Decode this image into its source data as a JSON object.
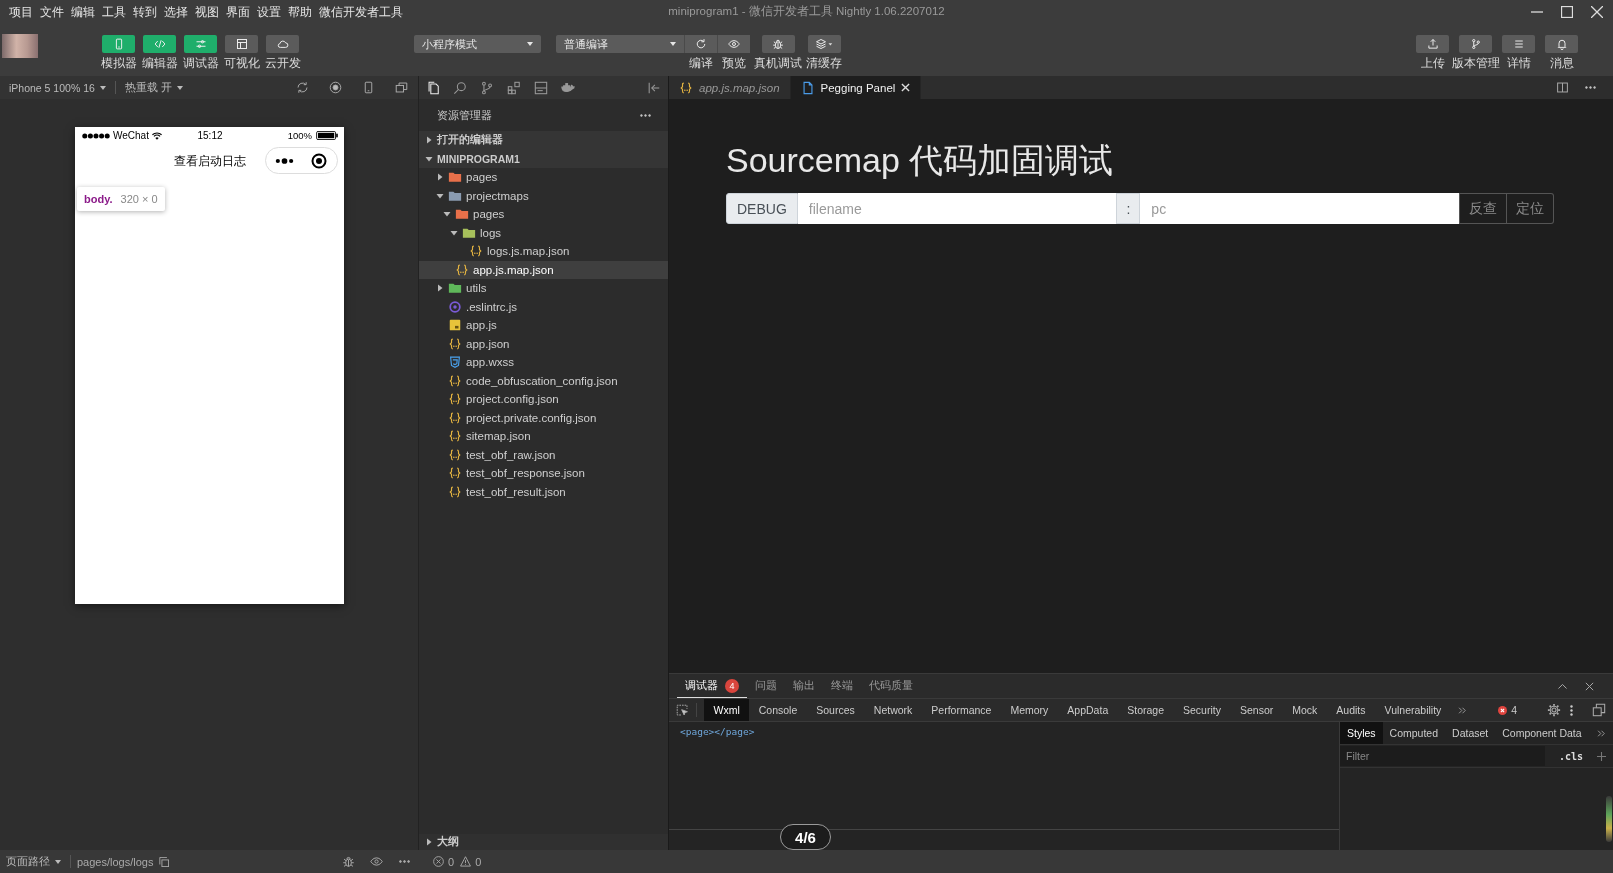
{
  "window": {
    "title": "miniprogram1 - 微信开发者工具 Nightly 1.06.2207012"
  },
  "menu": [
    "项目",
    "文件",
    "编辑",
    "工具",
    "转到",
    "选择",
    "视图",
    "界面",
    "设置",
    "帮助",
    "微信开发者工具"
  ],
  "toolbar": {
    "view_buttons": [
      {
        "label": "模拟器",
        "kind": "phone",
        "on": true
      },
      {
        "label": "编辑器",
        "kind": "code",
        "on": true
      },
      {
        "label": "调试器",
        "kind": "sliders",
        "on": true
      },
      {
        "label": "可视化",
        "kind": "layout",
        "on": false
      },
      {
        "label": "云开发",
        "kind": "cloud",
        "on": false
      }
    ],
    "mode_select": {
      "value": "小程序模式"
    },
    "compile_select": {
      "value": "普通编译"
    },
    "compile_actions": [
      {
        "label": "编译",
        "kind": "refresh"
      },
      {
        "label": "预览",
        "kind": "eye"
      }
    ],
    "debug_actions": [
      {
        "label": "真机调试",
        "kind": "bug"
      },
      {
        "label": "清缓存",
        "kind": "layers"
      }
    ],
    "right_actions": [
      {
        "label": "上传",
        "kind": "upload"
      },
      {
        "label": "版本管理",
        "kind": "branch"
      },
      {
        "label": "详情",
        "kind": "menu"
      },
      {
        "label": "消息",
        "kind": "bell"
      }
    ]
  },
  "simulator": {
    "device": "iPhone 5 100% 16",
    "hot_reload": "热重载 开",
    "phone": {
      "carrier": "WeChat",
      "time": "15:12",
      "battery": "100%",
      "nav_title": "查看启动日志"
    },
    "inspector_tooltip": {
      "tag": "body.",
      "size": "320 × 0"
    }
  },
  "explorer": {
    "title": "资源管理器",
    "sections": [
      {
        "label": "打开的编辑器",
        "expanded": false
      },
      {
        "label": "MINIPROGRAM1",
        "expanded": true,
        "children": [
          {
            "name": "pages",
            "kind": "folder",
            "color": "#e8704a",
            "expanded": false,
            "selected": false
          },
          {
            "name": "projectmaps",
            "kind": "folder",
            "color": "#8a9bb0",
            "expanded": true,
            "selected": false,
            "children": [
              {
                "name": "pages",
                "kind": "folder",
                "color": "#e8704a",
                "expanded": true,
                "selected": false,
                "children": [
                  {
                    "name": "logs",
                    "kind": "folder",
                    "color": "#a7c05b",
                    "expanded": true,
                    "selected": false,
                    "children": [
                      {
                        "name": "logs.js.map.json",
                        "kind": "json",
                        "selected": false
                      }
                    ]
                  }
                ]
              },
              {
                "name": "app.js.map.json",
                "kind": "json",
                "selected": true
              }
            ]
          },
          {
            "name": "utils",
            "kind": "folder",
            "color": "#5fb85a",
            "expanded": false,
            "selected": false
          },
          {
            "name": ".eslintrc.js",
            "kind": "eslint",
            "selected": false
          },
          {
            "name": "app.js",
            "kind": "js",
            "selected": false
          },
          {
            "name": "app.json",
            "kind": "json",
            "selected": false
          },
          {
            "name": "app.wxss",
            "kind": "wxss",
            "selected": false
          },
          {
            "name": "code_obfuscation_config.json",
            "kind": "json",
            "selected": false
          },
          {
            "name": "project.config.json",
            "kind": "json",
            "selected": false
          },
          {
            "name": "project.private.config.json",
            "kind": "json",
            "selected": false
          },
          {
            "name": "sitemap.json",
            "kind": "json",
            "selected": false
          },
          {
            "name": "test_obf_raw.json",
            "kind": "json",
            "selected": false
          },
          {
            "name": "test_obf_response.json",
            "kind": "json",
            "selected": false
          },
          {
            "name": "test_obf_result.json",
            "kind": "json",
            "selected": false
          }
        ]
      }
    ],
    "outline": {
      "label": "大纲",
      "expanded": false
    }
  },
  "editor": {
    "tabs": [
      {
        "label": "app.js.map.json",
        "kind": "json",
        "preview": true,
        "selected": false
      },
      {
        "label": "Pegging Panel",
        "kind": "page",
        "preview": false,
        "selected": true
      }
    ],
    "panel": {
      "title": "Sourcemap 代码加固调试",
      "prefix": "DEBUG",
      "file_field": {
        "placeholder": "filename"
      },
      "separator": ":",
      "pc_field": {
        "placeholder": "pc"
      },
      "buttons": [
        "反查",
        "定位"
      ]
    }
  },
  "debugger": {
    "panel_tabs": [
      {
        "label": "调试器",
        "badge": "4",
        "selected": true
      },
      {
        "label": "问题",
        "selected": false
      },
      {
        "label": "输出",
        "selected": false
      },
      {
        "label": "终端",
        "selected": false
      },
      {
        "label": "代码质量",
        "selected": false
      }
    ],
    "devtools_tabs": [
      {
        "label": "Wxml",
        "selected": true
      },
      {
        "label": "Console",
        "selected": false
      },
      {
        "label": "Sources",
        "selected": false
      },
      {
        "label": "Network",
        "selected": false
      },
      {
        "label": "Performance",
        "selected": false
      },
      {
        "label": "Memory",
        "selected": false
      },
      {
        "label": "AppData",
        "selected": false
      },
      {
        "label": "Storage",
        "selected": false
      },
      {
        "label": "Security",
        "selected": false
      },
      {
        "label": "Sensor",
        "selected": false
      },
      {
        "label": "Mock",
        "selected": false
      },
      {
        "label": "Audits",
        "selected": false
      },
      {
        "label": "Vulnerability",
        "selected": false
      }
    ],
    "error_count": "4",
    "wxml": "<page></page>",
    "style_tabs": [
      {
        "label": "Styles",
        "selected": true
      },
      {
        "label": "Computed",
        "selected": false
      },
      {
        "label": "Dataset",
        "selected": false
      },
      {
        "label": "Component Data",
        "selected": false
      }
    ],
    "filter": {
      "placeholder": "Filter"
    },
    "cls": ".cls"
  },
  "page_indicator": "4/6",
  "status_bar": {
    "page_path_label": "页面路径",
    "page_path": "pages/logs/logs",
    "errors": "0",
    "warnings": "0"
  }
}
